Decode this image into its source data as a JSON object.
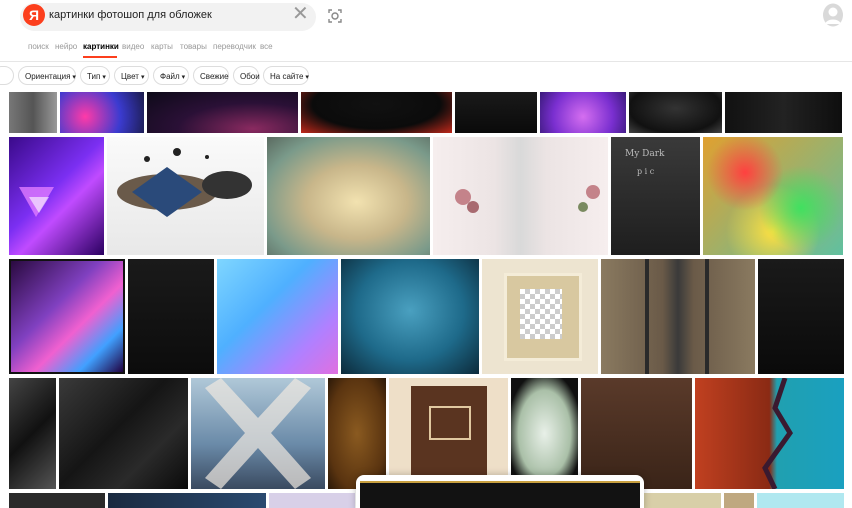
{
  "search": {
    "logo_letter": "Я",
    "query": "картинки фотошоп для обложек",
    "clear_symbol": "✕"
  },
  "tabs": [
    {
      "label": "поиск"
    },
    {
      "label": "нейро"
    },
    {
      "label": "картинки"
    },
    {
      "label": "видео"
    },
    {
      "label": "карты"
    },
    {
      "label": "товары"
    },
    {
      "label": "переводчик"
    },
    {
      "label": "все"
    }
  ],
  "active_tab": "картинки",
  "filters": [
    {
      "label": "Ориентация",
      "dropdown": true
    },
    {
      "label": "Тип",
      "dropdown": true
    },
    {
      "label": "Цвет",
      "dropdown": true
    },
    {
      "label": "Файл",
      "dropdown": true
    },
    {
      "label": "Свежие",
      "dropdown": false
    },
    {
      "label": "Обои",
      "dropdown": false
    },
    {
      "label": "На сайте",
      "dropdown": true
    }
  ],
  "image_text": {
    "chalkboard_caption": "My Dark",
    "chalkboard_caption2": "p i c"
  },
  "colors": {
    "brand": "#fc3f1d",
    "accent_underline": "#fc3f1d"
  }
}
